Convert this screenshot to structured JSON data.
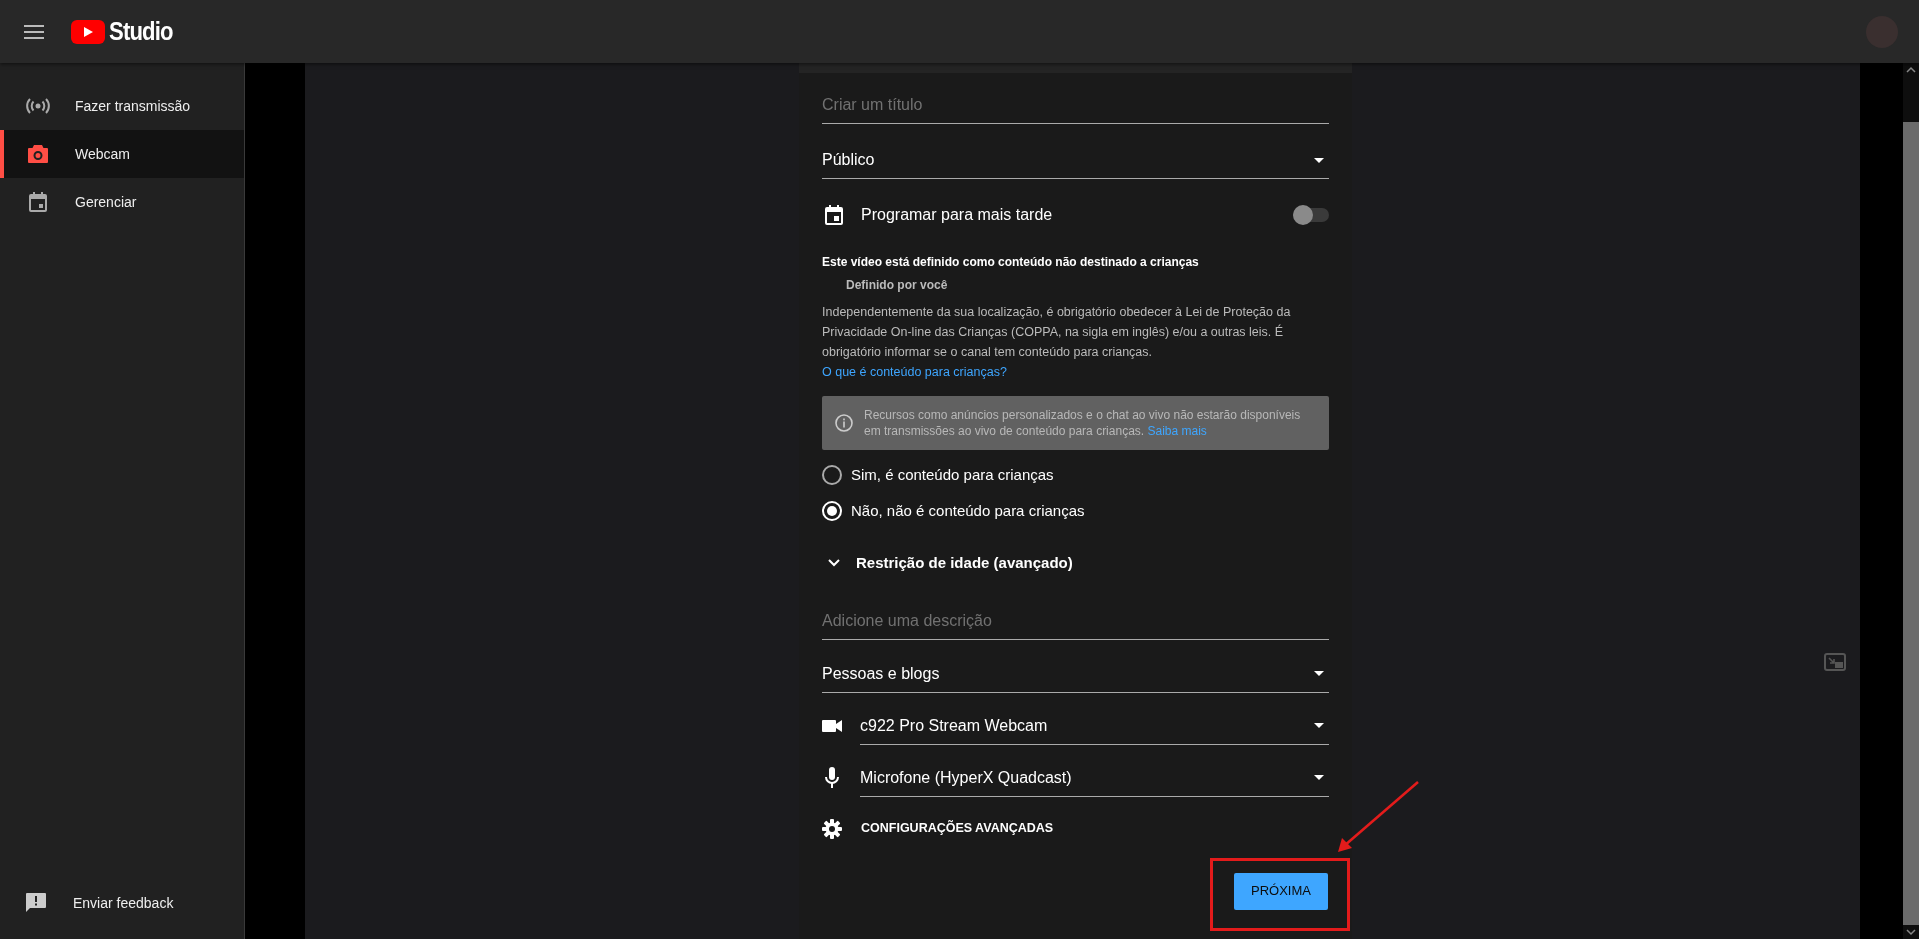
{
  "header": {
    "logo_text": "Studio"
  },
  "sidebar": {
    "items": [
      {
        "kind": "broadcast",
        "label": "Fazer transmissão",
        "selected": false
      },
      {
        "kind": "camera",
        "label": "Webcam",
        "selected": true
      },
      {
        "kind": "calendar",
        "label": "Gerenciar",
        "selected": false
      }
    ],
    "footer": {
      "label": "Enviar feedback"
    }
  },
  "form": {
    "title_field": {
      "placeholder": "Criar um título"
    },
    "visibility": {
      "value": "Público"
    },
    "schedule": {
      "label": "Programar para mais tarde",
      "on": false
    },
    "audience": {
      "heading": "Este vídeo está definido como conteúdo não destinado a crianças",
      "subheading": "Definido por você",
      "body": "Independentemente da sua localização, é obrigatório obedecer à Lei de Proteção da Privacidade On-line das Crianças (COPPA, na sigla em inglês) e/ou a outras leis. É obrigatório informar se o canal tem conteúdo para crianças.",
      "link": "O que é conteúdo para crianças?"
    },
    "notice": {
      "text": "Recursos como anúncios personalizados e o chat ao vivo não estarão disponíveis em transmissões ao vivo de conteúdo para crianças.",
      "link": "Saiba mais"
    },
    "radios": [
      {
        "label": "Sim, é conteúdo para crianças",
        "selected": false
      },
      {
        "label": "Não, não é conteúdo para crianças",
        "selected": true
      }
    ],
    "age_restriction": {
      "label": "Restrição de idade (avançado)",
      "expanded": false
    },
    "description_field": {
      "placeholder": "Adicione uma descrição"
    },
    "category": {
      "value": "Pessoas e blogs"
    },
    "devices": [
      {
        "kind": "camera",
        "value": "c922 Pro Stream Webcam"
      },
      {
        "kind": "microphone",
        "value": "Microfone (HyperX Quadcast)"
      }
    ],
    "advanced": {
      "label": "CONFIGURAÇÕES AVANÇADAS"
    },
    "next_button": {
      "label": "PRÓXIMA"
    }
  }
}
